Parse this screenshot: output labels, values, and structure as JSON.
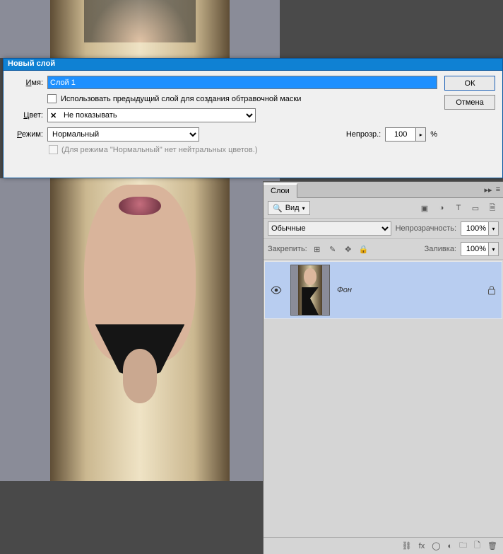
{
  "dialog": {
    "title": "Новый слой",
    "name_label_html": "Имя:",
    "name_underline_char": "И",
    "name_label": "мя:",
    "name_value": "Слой 1",
    "clip_checkbox_label": "Использовать предыдущий слой для создания обтравочной маски",
    "color_label": "Цвет:",
    "color_underline_char": "Ц",
    "color_value": "Не показывать",
    "mode_label": "ежим:",
    "mode_underline_char": "Р",
    "mode_value": "Нормальный",
    "opacity_label": "Непрозр.:",
    "opacity_value": "100",
    "opacity_pct": "%",
    "neutral_note": "(Для режима \"Нормальный\" нет нейтральных цветов.)",
    "ok_label": "ОК",
    "cancel_label": "Отмена"
  },
  "layers_panel": {
    "tab_label": "Слои",
    "filter_label": "Вид",
    "blend_value": "Обычные",
    "opacity_label": "Непрозрачность:",
    "opacity_value": "100%",
    "lock_label": "Закрепить:",
    "fill_label": "Заливка:",
    "fill_value": "100%",
    "layer_name": "Фон"
  },
  "icons": {
    "flyout": "▸▸",
    "menu": "≡",
    "search": "🔍",
    "caret": "▾",
    "image": "img",
    "adjust": "◑",
    "type": "T",
    "shape": "▭",
    "smart": "🗎",
    "eye": "👁",
    "lock": "🔒",
    "link": "⛓",
    "fx": "fx",
    "mask": "◯",
    "fill": "◐",
    "folder": "🗀",
    "new": "🗋",
    "trash": "🗑",
    "pixels": "⊞",
    "brush": "✎",
    "move": "✥",
    "arrow_r": "▸"
  }
}
